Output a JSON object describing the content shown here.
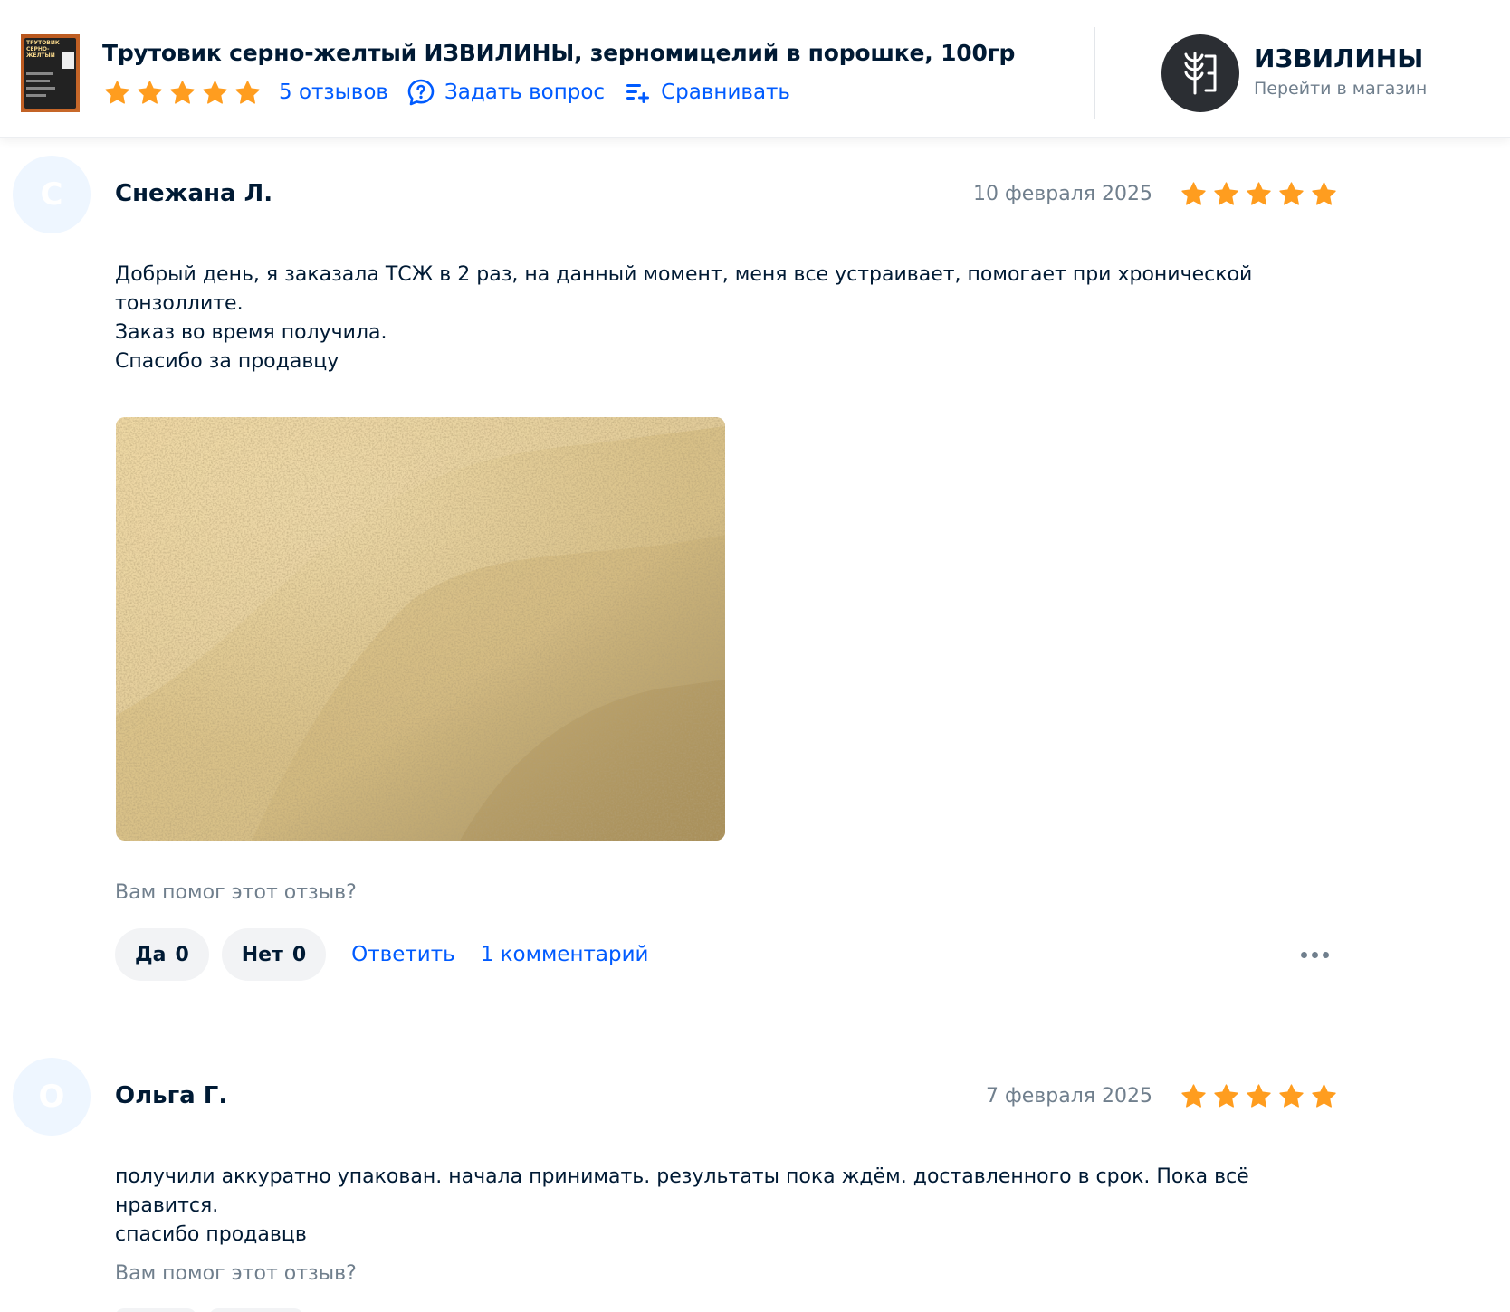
{
  "header": {
    "title": "Трутовик серно-желтый ИЗВИЛИНЫ, зерномицелий в порошке, 100гр",
    "thumb_label": "ТРУТОВИК СЕРНО-ЖЕЛТЫЙ",
    "rating_stars": 5,
    "reviews_link": "5 отзывов",
    "ask_link": "Задать вопрос",
    "compare_link": "Сравнивать",
    "shop_name": "ИЗВИЛИНЫ",
    "shop_link": "Перейти в магазин"
  },
  "colors": {
    "accent": "#005bff",
    "star": "#ff9d1f",
    "muted": "#707f8d",
    "title": "#001a34",
    "avatar_bg": "#eef6ff"
  },
  "reviews": [
    {
      "avatar_letter": "С",
      "author": "Снежана Л.",
      "date": "10 февраля 2025",
      "stars": 5,
      "text_lines": [
        "Добрый день, я заказала ТСЖ в 2 раз, на данный момент, меня все устраивает, помогает при хронической",
        "тонзоллите.",
        "Заказ во время получила.",
        "Спасибо за продавцу"
      ],
      "helpful_question": "Вам помог этот отзыв?",
      "yes_label": "Да",
      "yes_count": "0",
      "no_label": "Нет",
      "no_count": "0",
      "reply_link": "Ответить",
      "comments_link": "1 комментарий"
    },
    {
      "avatar_letter": "О",
      "author": "Ольга Г.",
      "date": "7 февраля 2025",
      "stars": 5,
      "text_lines": [
        "получили аккуратно упакован. начала принимать. результаты пока ждём. доставленного в срок. Пока всё нравится.",
        "спасибо продавцв"
      ],
      "helpful_question": "Вам помог этот отзыв?"
    }
  ]
}
